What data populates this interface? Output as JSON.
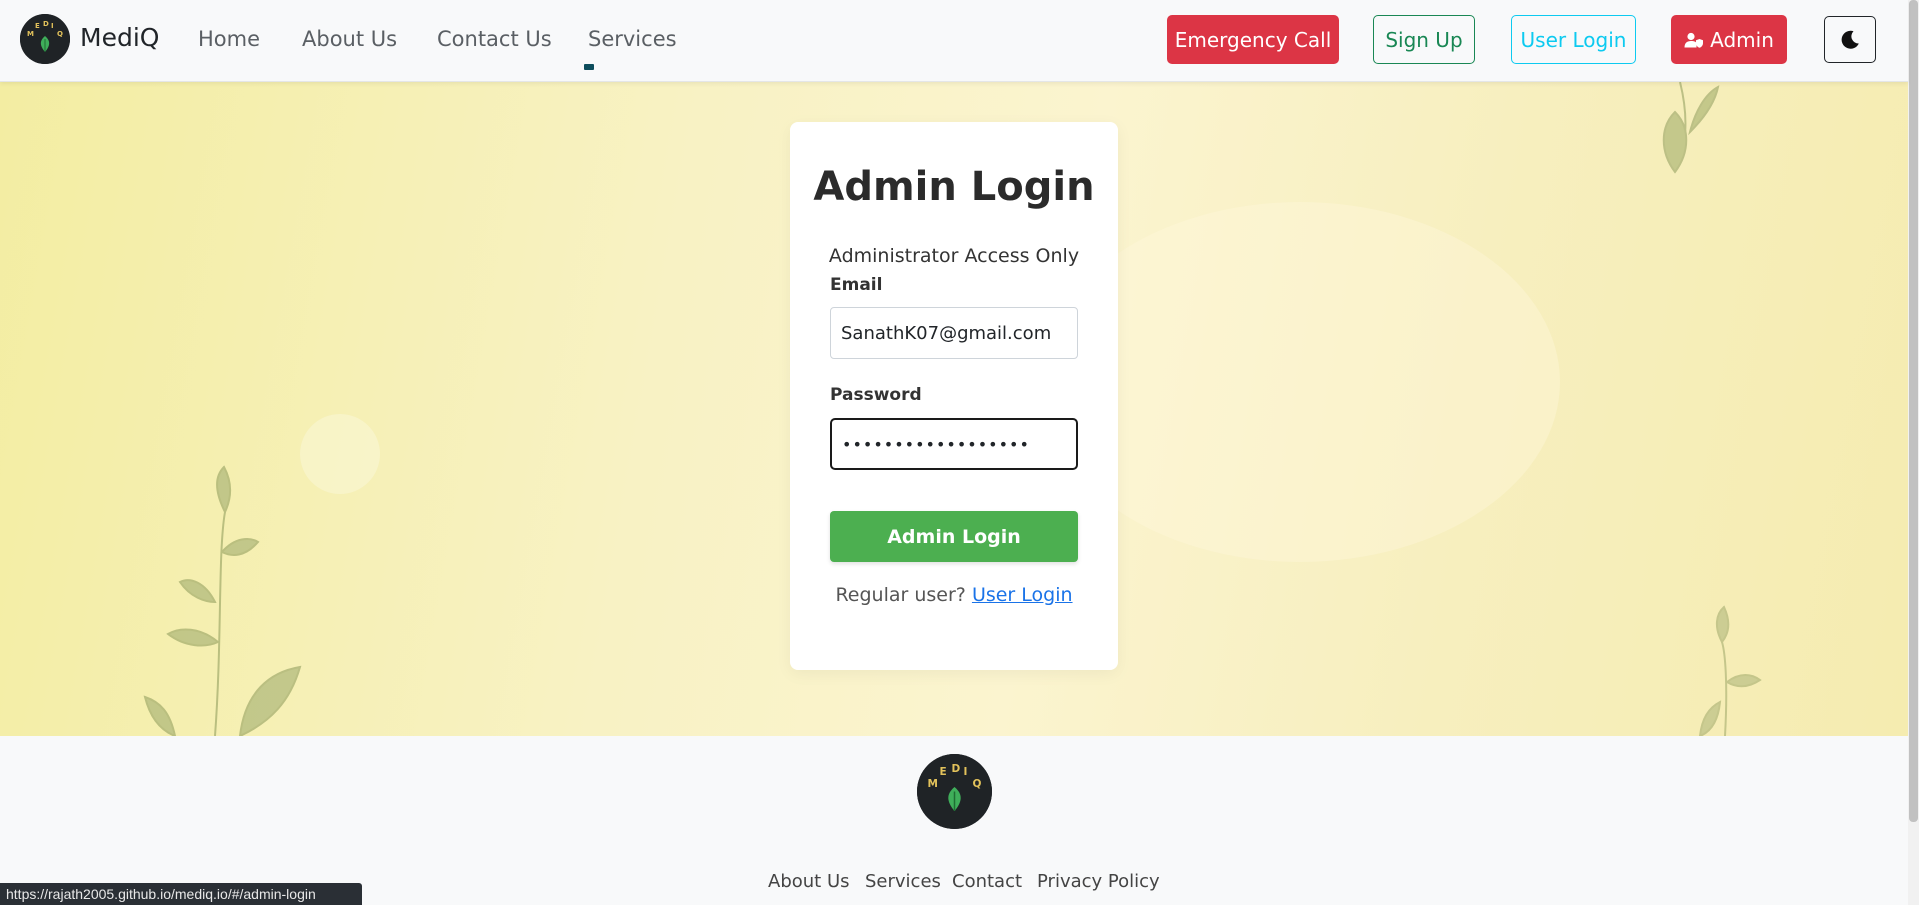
{
  "brand": {
    "name": "MediQ",
    "logo_text": "MEDIQ"
  },
  "nav": {
    "home": "Home",
    "about": "About Us",
    "contact": "Contact Us",
    "services": "Services"
  },
  "header_buttons": {
    "emergency": "Emergency Call",
    "signup": "Sign Up",
    "user_login": "User Login",
    "admin": "Admin",
    "theme_icon": "moon-icon"
  },
  "login_card": {
    "title": "Admin Login",
    "subtitle": "Administrator Access Only",
    "email_label": "Email",
    "email_value": "SanathK07@gmail.com",
    "password_label": "Password",
    "password_value": "••••••••••••••••••",
    "submit_label": "Admin Login",
    "regular_prefix": "Regular user?",
    "regular_link": "User Login"
  },
  "footer": {
    "links": [
      "About Us",
      "Services",
      "Contact",
      "Privacy Policy"
    ]
  },
  "status_bar": {
    "url": "https://rajath2005.github.io/mediq.io/#/admin-login"
  },
  "colors": {
    "danger": "#dc3545",
    "success": "#198754",
    "info": "#0dcaf0",
    "submit_green": "#4caf50",
    "link_blue": "#1a73e8"
  }
}
